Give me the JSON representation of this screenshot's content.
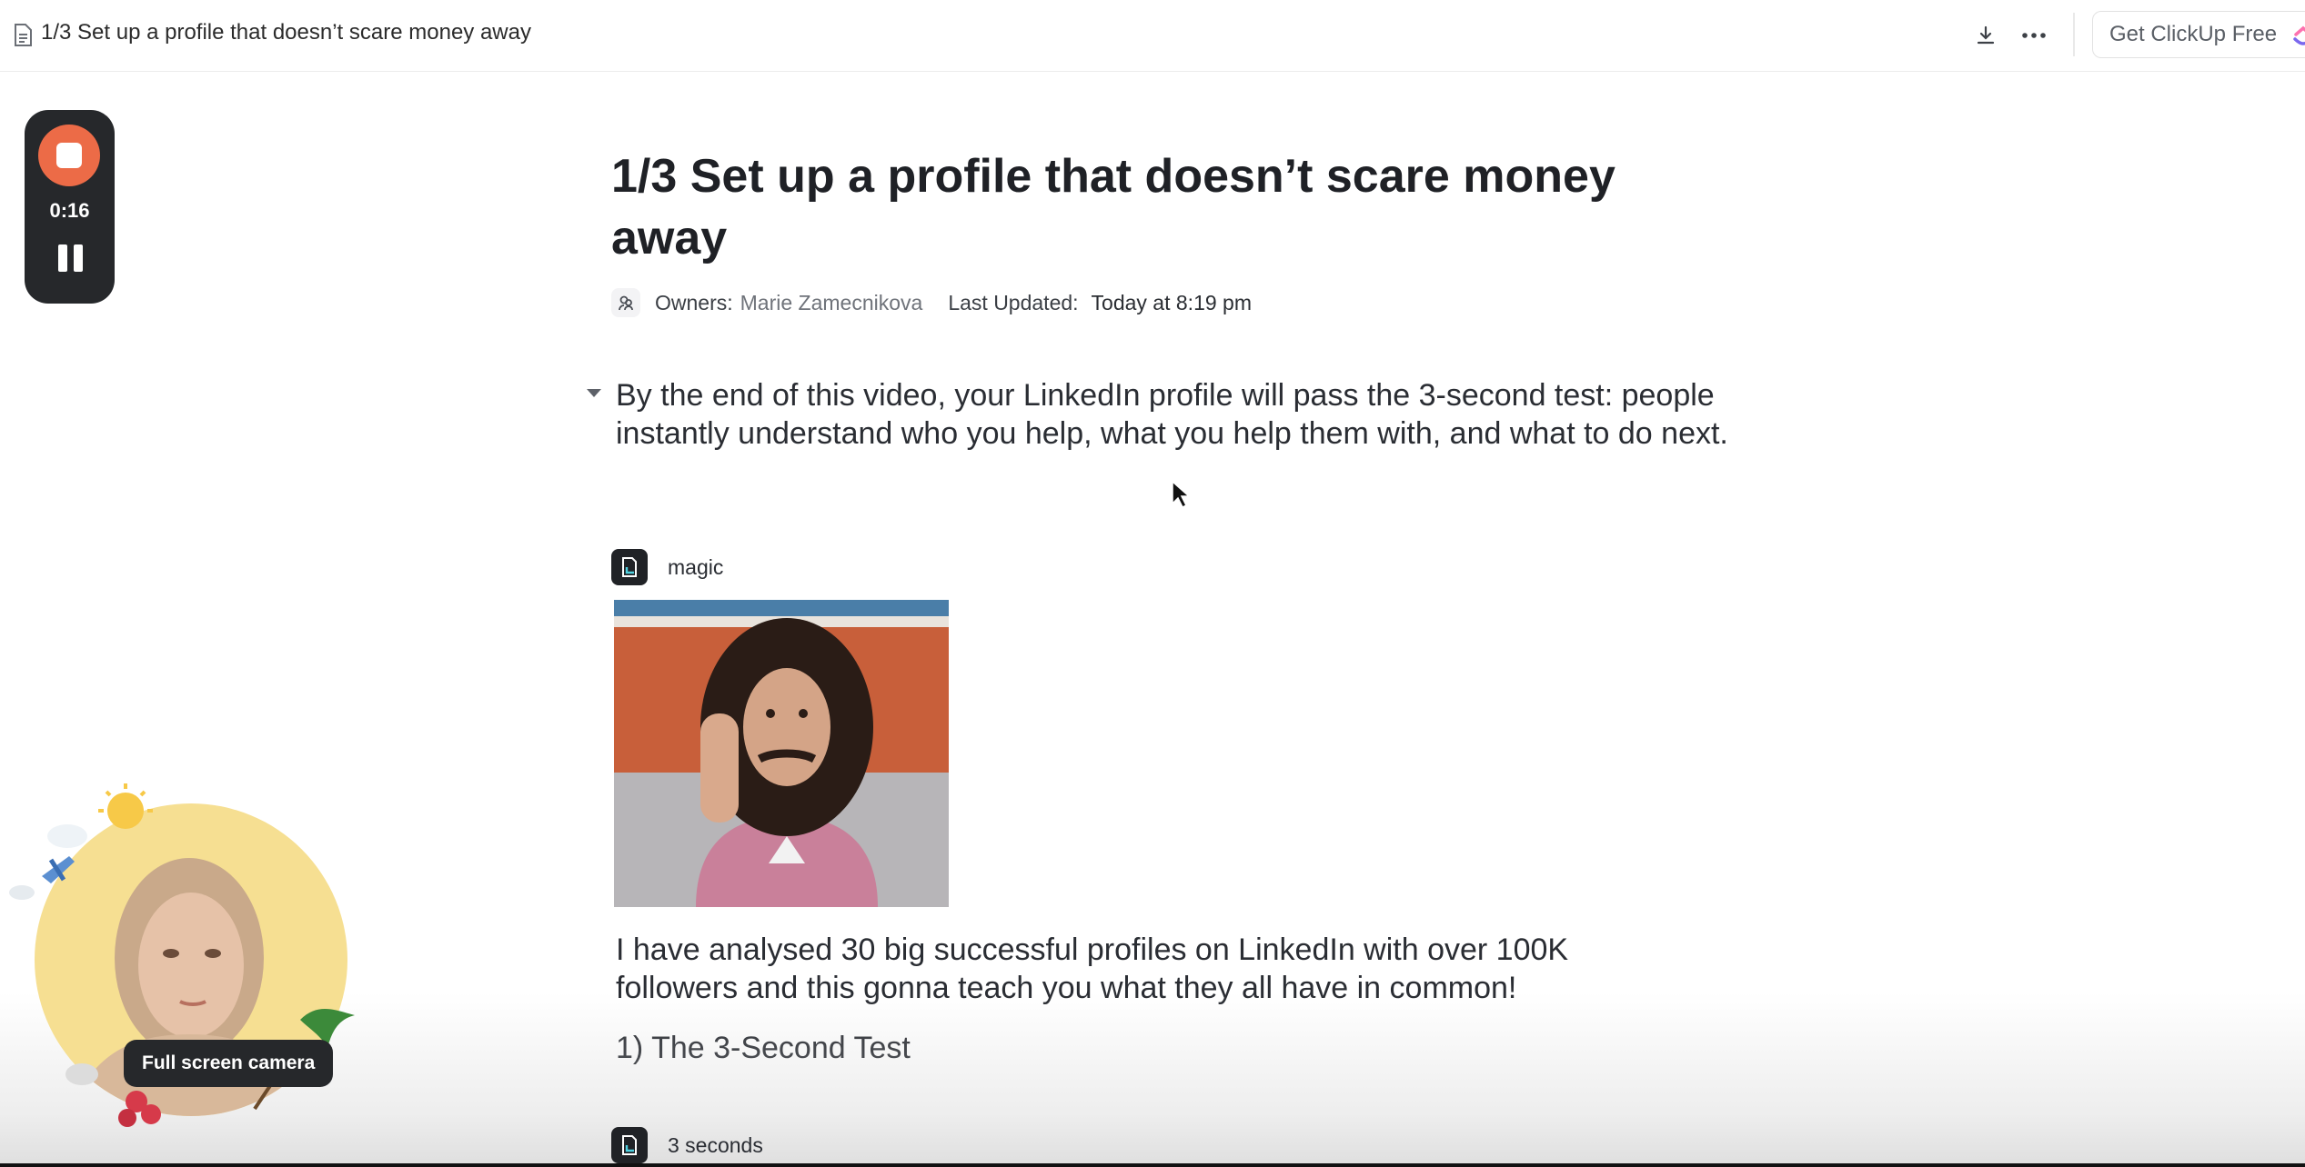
{
  "topbar": {
    "title": "1/3 Set up a profile that doesn’t scare money away",
    "get_clickup": "Get ClickUp Free"
  },
  "recorder": {
    "elapsed": "0:16"
  },
  "doc": {
    "title": "1/3 Set up a profile that doesn’t scare money away",
    "owners_label": "Owners:",
    "owners_value": "Marie Zamecnikova",
    "updated_label": "Last Updated:",
    "updated_value": "Today at 8:19 pm",
    "intro": "By the end of this video, your LinkedIn profile will pass the 3-second test: people instantly understand who you help, what you help them with, and what to do next.",
    "block1_label": "magic",
    "paragraph": "I have analysed 30 big successful profiles on LinkedIn with over 100K followers and this gonna teach you what they all have in common!",
    "section_heading": "1) The 3-Second Test",
    "block2_label": "3 seconds"
  },
  "camera": {
    "button_label": "Full screen camera"
  },
  "colors": {
    "record_accent": "#ec6b47",
    "widget_bg": "#26282b",
    "camera_bg": "#f6df92"
  },
  "icons": [
    "doc-icon",
    "download-icon",
    "more-icon",
    "clickup-logo-icon",
    "stop-icon",
    "pause-icon",
    "owner-icon",
    "collapse-arrow-icon",
    "cursor-icon",
    "clip-icon"
  ]
}
